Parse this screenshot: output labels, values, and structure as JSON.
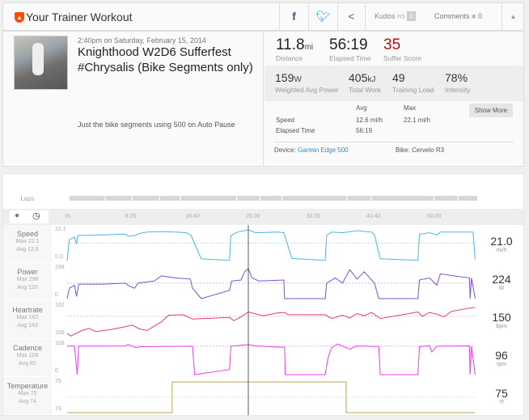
{
  "header": {
    "title": "Your Trainer Workout",
    "kudos_label": "Kudos",
    "kudos_count": "0",
    "comments_label": "Comments",
    "comments_count": "0"
  },
  "activity": {
    "datetime": "2:40pm on Saturday, February 15, 2014",
    "name": "Knighthood W2D6 Sufferfest #Chrysalis (Bike Segments only)",
    "description": "Just the bike segments using 500 on Auto Pause"
  },
  "stats": {
    "primary": [
      {
        "value": "11.8",
        "unit": "mi",
        "label": "Distance"
      },
      {
        "value": "56:19",
        "unit": "",
        "label": "Elapsed Time"
      },
      {
        "value": "35",
        "unit": "",
        "label": "Suffer Score"
      }
    ],
    "secondary": [
      {
        "value": "159",
        "unit": "W",
        "label": "Weighted Avg Power"
      },
      {
        "value": "405",
        "unit": "kJ",
        "label": "Total Work"
      },
      {
        "value": "49",
        "unit": "",
        "label": "Training Load"
      },
      {
        "value": "78%",
        "unit": "",
        "label": "Intensity"
      }
    ],
    "table": {
      "col_avg": "Avg",
      "col_max": "Max",
      "rows": [
        {
          "label": "Speed",
          "avg": "12.6 mi/h",
          "max": "22.1 mi/h"
        },
        {
          "label": "Elapsed Time",
          "avg": "56:19",
          "max": ""
        }
      ]
    },
    "show_more": "Show More",
    "device_label": "Device:",
    "device": "Garmin Edge 500",
    "bike_label": "Bike:",
    "bike": "Cervelo R3"
  },
  "colors": {
    "accent": "#fc4c02",
    "suffer": "#b20f0f",
    "link": "#2f8fce"
  },
  "chart_data": {
    "type": "line",
    "laps_label": "Laps",
    "x_ticks": [
      "0s",
      "8:20",
      "16:40",
      "25:00",
      "33:20",
      "41:40",
      "50:00"
    ],
    "x_tick_minutes": [
      0,
      8.333,
      16.667,
      25,
      33.333,
      41.667,
      50
    ],
    "x_range_minutes": [
      0,
      56.32
    ],
    "cursor_minute": 25,
    "laps_minutes": [
      [
        0,
        7.1
      ],
      [
        7.3,
        12.5
      ],
      [
        12.7,
        18
      ],
      [
        18.2,
        22.2
      ],
      [
        22.4,
        33.5
      ],
      [
        33.7,
        38.2
      ],
      [
        38.4,
        42.6
      ],
      [
        42.8,
        55.7
      ],
      [
        55.9,
        60.6
      ],
      [
        60.8,
        73.2
      ],
      [
        73.4,
        78
      ],
      [
        78.2,
        82
      ]
    ],
    "series": [
      {
        "name": "Speed",
        "max_label": "Max 22.1",
        "avg_label": "Avg 12.6",
        "current": "21.0",
        "unit": "mi/h",
        "ylim": [
          0,
          22.1
        ],
        "yticks": [
          "22.1",
          "0.0"
        ],
        "avg": 12.6,
        "color": "#4bb4e6",
        "points": [
          [
            0,
            0
          ],
          [
            0.3,
            15
          ],
          [
            1,
            17
          ],
          [
            1.3,
            12
          ],
          [
            1.5,
            18
          ],
          [
            5,
            18.5
          ],
          [
            8,
            19
          ],
          [
            8.5,
            17.5
          ],
          [
            9.3,
            18
          ],
          [
            10,
            19.5
          ],
          [
            11,
            20.5
          ],
          [
            13,
            20.8
          ],
          [
            15,
            20.5
          ],
          [
            16.5,
            20
          ],
          [
            17.1,
            18
          ],
          [
            18.5,
            1.2
          ],
          [
            22.4,
            0.2
          ],
          [
            22.6,
            18
          ],
          [
            23.5,
            20.5
          ],
          [
            25,
            22.1
          ],
          [
            26,
            20
          ],
          [
            29,
            20.5
          ],
          [
            29.9,
            20
          ],
          [
            31,
            1.5
          ],
          [
            35.6,
            0.2
          ],
          [
            35.8,
            18
          ],
          [
            36.5,
            20.5
          ],
          [
            38,
            20
          ],
          [
            40,
            21.5
          ],
          [
            42,
            20.5
          ],
          [
            42.4,
            18.5
          ],
          [
            43.2,
            1.3
          ],
          [
            48.4,
            0.2
          ],
          [
            48.6,
            19
          ],
          [
            50,
            20
          ],
          [
            51,
            18.5
          ],
          [
            51.5,
            20.5
          ],
          [
            56,
            20.5
          ],
          [
            56.3,
            0.8
          ]
        ]
      },
      {
        "name": "Power",
        "max_label": "Max 298",
        "avg_label": "Avg 120",
        "current": "224",
        "unit": "W",
        "ylim": [
          0,
          298
        ],
        "yticks": [
          "298",
          "0"
        ],
        "avg": 150,
        "color": "#7b4fd6",
        "points": [
          [
            0,
            0
          ],
          [
            0.3,
            100
          ],
          [
            1,
            130
          ],
          [
            1.3,
            20
          ],
          [
            1.6,
            140
          ],
          [
            5,
            140
          ],
          [
            8,
            150
          ],
          [
            8.6,
            120
          ],
          [
            9.3,
            100
          ],
          [
            9.8,
            150
          ],
          [
            12,
            170
          ],
          [
            13,
            220
          ],
          [
            15,
            200
          ],
          [
            17,
            190
          ],
          [
            17.3,
            100
          ],
          [
            18.5,
            0
          ],
          [
            22.4,
            80
          ],
          [
            22.7,
            170
          ],
          [
            24,
            180
          ],
          [
            24.5,
            260
          ],
          [
            25,
            290
          ],
          [
            25.5,
            200
          ],
          [
            26.5,
            170
          ],
          [
            29.9,
            180
          ],
          [
            30,
            0
          ],
          [
            35.6,
            0
          ],
          [
            35.8,
            150
          ],
          [
            37,
            200
          ],
          [
            38,
            150
          ],
          [
            39,
            280
          ],
          [
            40,
            190
          ],
          [
            41,
            260
          ],
          [
            42.4,
            150
          ],
          [
            43,
            0
          ],
          [
            48.4,
            0
          ],
          [
            48.6,
            180
          ],
          [
            50,
            200
          ],
          [
            51,
            130
          ],
          [
            51.5,
            240
          ],
          [
            55.5,
            200
          ],
          [
            55.6,
            0
          ],
          [
            55.8,
            200
          ],
          [
            56.3,
            0
          ]
        ]
      },
      {
        "name": "Heartrate",
        "max_label": "Max 162",
        "avg_label": "Avg 143",
        "current": "150",
        "unit": "bpm",
        "ylim": [
          106,
          162
        ],
        "yticks": [
          "162",
          "106"
        ],
        "avg": 143,
        "color": "#e0406c",
        "points": [
          [
            0,
            112
          ],
          [
            0.5,
            107
          ],
          [
            2,
            117
          ],
          [
            3,
            121
          ],
          [
            4,
            115
          ],
          [
            6,
            119
          ],
          [
            8,
            124
          ],
          [
            9,
            127
          ],
          [
            10,
            120
          ],
          [
            11,
            117
          ],
          [
            12,
            125
          ],
          [
            13,
            133
          ],
          [
            14,
            145
          ],
          [
            16,
            146
          ],
          [
            17.3,
            138
          ],
          [
            22.4,
            141
          ],
          [
            23,
            135
          ],
          [
            24,
            142
          ],
          [
            25,
            151
          ],
          [
            27,
            144
          ],
          [
            29,
            149
          ],
          [
            30,
            150
          ],
          [
            30.5,
            146
          ],
          [
            35.6,
            146
          ],
          [
            36.5,
            139
          ],
          [
            38,
            145
          ],
          [
            39,
            140
          ],
          [
            40,
            148
          ],
          [
            41,
            144
          ],
          [
            42,
            150
          ],
          [
            43.2,
            139
          ],
          [
            48.4,
            151
          ],
          [
            49,
            143
          ],
          [
            50,
            150
          ],
          [
            51,
            147
          ],
          [
            52,
            142
          ],
          [
            53,
            152
          ],
          [
            56,
            159
          ],
          [
            56.3,
            158
          ]
        ]
      },
      {
        "name": "Cadence",
        "max_label": "Max 108",
        "avg_label": "Avg 81",
        "current": "96",
        "unit": "rpm",
        "ylim": [
          0,
          108
        ],
        "yticks": [
          "108",
          "0"
        ],
        "avg": 100,
        "color": "#e63fe6",
        "points": [
          [
            0,
            100
          ],
          [
            1,
            101
          ],
          [
            1.4,
            0
          ],
          [
            1.6,
            100
          ],
          [
            8,
            101
          ],
          [
            8.4,
            106
          ],
          [
            9.5,
            95
          ],
          [
            10,
            98
          ],
          [
            17.3,
            100
          ],
          [
            17.6,
            0
          ],
          [
            22.4,
            18
          ],
          [
            22.6,
            100
          ],
          [
            25,
            106
          ],
          [
            26,
            101
          ],
          [
            30,
            96
          ],
          [
            30.1,
            0
          ],
          [
            35.6,
            0
          ],
          [
            36,
            60
          ],
          [
            36.5,
            95
          ],
          [
            37.3,
            108
          ],
          [
            38,
            100
          ],
          [
            39,
            90
          ],
          [
            40,
            101
          ],
          [
            43,
            99
          ],
          [
            43.2,
            0
          ],
          [
            48.4,
            0
          ],
          [
            48.6,
            98
          ],
          [
            50,
            102
          ],
          [
            50.3,
            80
          ],
          [
            51,
            100
          ],
          [
            55.5,
            101
          ],
          [
            55.6,
            0
          ],
          [
            55.8,
            100
          ],
          [
            56.3,
            0
          ]
        ]
      },
      {
        "name": "Temperature",
        "max_label": "Max 75",
        "avg_label": "Avg 74",
        "current": "75",
        "unit": "°F",
        "ylim": [
          73,
          75
        ],
        "yticks": [
          "75",
          "73"
        ],
        "avg": 74,
        "color": "#b8a94f",
        "points": [
          [
            0,
            73
          ],
          [
            14.5,
            73
          ],
          [
            14.5,
            75
          ],
          [
            38.5,
            75
          ],
          [
            38.5,
            73
          ],
          [
            56.3,
            73
          ]
        ]
      }
    ]
  }
}
